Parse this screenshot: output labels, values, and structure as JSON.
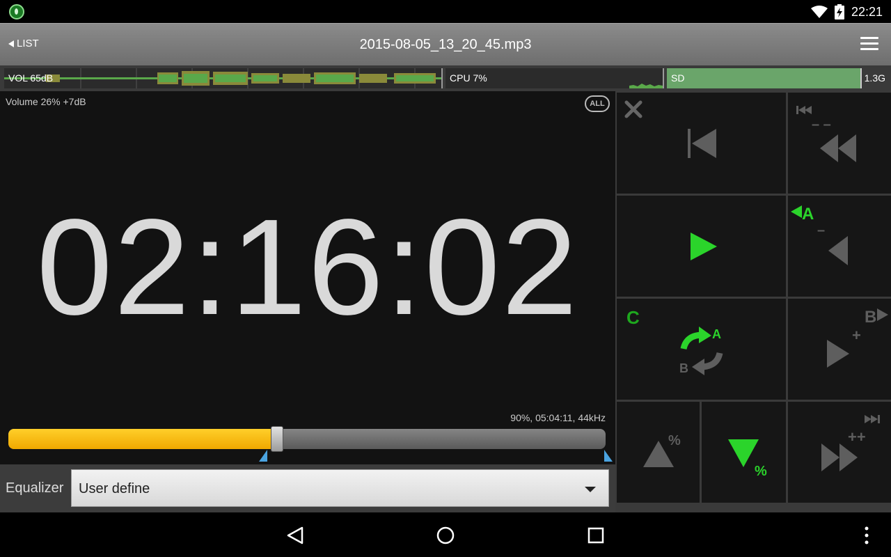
{
  "status_bar": {
    "time": "22:21",
    "icons": [
      "music-app-icon",
      "wifi-icon",
      "battery-charging-icon"
    ]
  },
  "toolbar": {
    "back_label": "LIST",
    "title": "2015-08-05_13_20_45.mp3",
    "menu_icon": "hamburger-menu-icon"
  },
  "meters": {
    "vol_label": "VOL 65dB",
    "cpu_label": "CPU 7%",
    "sd_label": "SD",
    "sd_free": "1.3G"
  },
  "display": {
    "volume_text": "Volume 26% +7dB",
    "repeat_all_label": "ALL",
    "time": "02:16:02",
    "track_info": "90%, 05:04:11, 44kHz",
    "progress": 0.45,
    "marker_a": 0.43,
    "marker_b": 1.0
  },
  "equalizer": {
    "label": "Equalizer",
    "value": "User define"
  },
  "controls": {
    "close": "close-icon",
    "prev_track": "previous-track-icon",
    "rewind": "rewind-icon",
    "play": "play-icon",
    "set_a_back": "set-a-back-icon",
    "repeat_ab": "repeat-ab-icon",
    "repeat_c_label": "C",
    "repeat_a_label": "A",
    "repeat_b_label": "B",
    "set_a_label": "A",
    "set_b_label": "B",
    "forward_b": "b-forward-icon",
    "speed_up": "speed-up-icon",
    "speed_down": "speed-down-icon",
    "fast_forward": "fast-forward-icon",
    "percent_label": "%",
    "plus_label": "+",
    "plusplus_label": "++",
    "minus_label": "–",
    "minusminus_label": "– –",
    "colors": {
      "active_green": "#2bd42b",
      "inactive_gray": "#5e5e5e"
    }
  },
  "navbar": {
    "back": "nav-back-icon",
    "home": "nav-home-icon",
    "recents": "nav-recents-icon",
    "overflow": "nav-overflow-icon"
  }
}
